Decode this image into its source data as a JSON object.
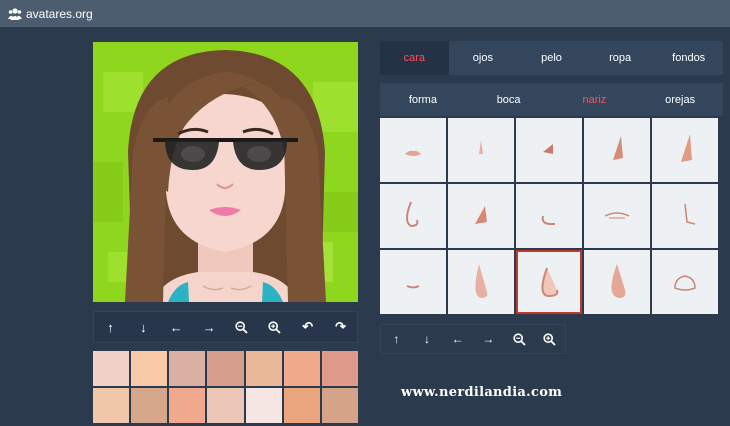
{
  "app": {
    "title": "avatares.org",
    "logo_icon": "users-icon"
  },
  "avatar_controls": [
    {
      "icon": "arrow-up-icon",
      "glyph": "↑"
    },
    {
      "icon": "arrow-down-icon",
      "glyph": "↓"
    },
    {
      "icon": "arrow-left-icon",
      "glyph": "←"
    },
    {
      "icon": "arrow-right-icon",
      "glyph": "→"
    },
    {
      "icon": "zoom-out-icon",
      "glyph": ""
    },
    {
      "icon": "zoom-in-icon",
      "glyph": ""
    },
    {
      "icon": "rotate-left-icon",
      "glyph": "↶"
    },
    {
      "icon": "rotate-right-icon",
      "glyph": "↷"
    }
  ],
  "skin_colors": [
    "#f2d2c7",
    "#f9c9a8",
    "#d9b0a3",
    "#d49f8c",
    "#e8b898",
    "#f0a98a",
    "#df9a8a",
    "#f0c8a9",
    "#d7a78b",
    "#f1a98e",
    "#ecc6b6",
    "#f5e6e4",
    "#eaa57e",
    "#d5a488"
  ],
  "main_tabs": [
    {
      "label": "cara",
      "active": true
    },
    {
      "label": "ojos",
      "active": false
    },
    {
      "label": "pelo",
      "active": false
    },
    {
      "label": "ropa",
      "active": false
    },
    {
      "label": "fondos",
      "active": false
    }
  ],
  "sub_tabs": [
    {
      "label": "forma",
      "active": false
    },
    {
      "label": "boca",
      "active": false
    },
    {
      "label": "nariz",
      "active": true
    },
    {
      "label": "orejas",
      "active": false
    }
  ],
  "nose_options": {
    "count": 15,
    "selected_index": 12
  },
  "part_controls": [
    {
      "icon": "arrow-up-icon",
      "glyph": "↑"
    },
    {
      "icon": "arrow-down-icon",
      "glyph": "↓"
    },
    {
      "icon": "arrow-left-icon",
      "glyph": "←"
    },
    {
      "icon": "arrow-right-icon",
      "glyph": "→"
    },
    {
      "icon": "zoom-out-icon",
      "glyph": ""
    },
    {
      "icon": "zoom-in-icon",
      "glyph": ""
    }
  ],
  "watermark": "www.nerdilandia.com",
  "colors": {
    "accent": "#ff4d5e",
    "background": "#2b3a4d",
    "avatar_bg": "#8fd61f"
  }
}
